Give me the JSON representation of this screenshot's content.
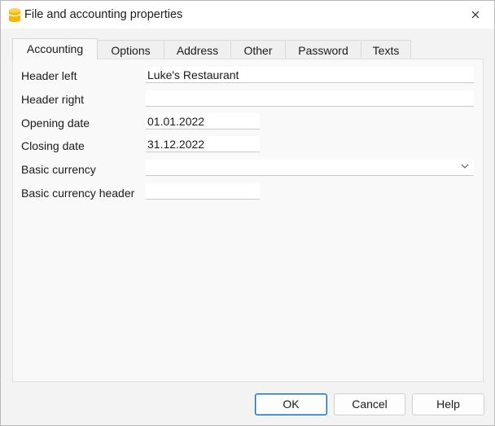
{
  "window": {
    "title": "File and accounting properties"
  },
  "tabs": [
    {
      "label": "Accounting",
      "active": true
    },
    {
      "label": "Options"
    },
    {
      "label": "Address"
    },
    {
      "label": "Other"
    },
    {
      "label": "Password"
    },
    {
      "label": "Texts"
    }
  ],
  "form": {
    "header_left": {
      "label": "Header left",
      "value": "Luke's Restaurant"
    },
    "header_right": {
      "label": "Header right",
      "value": ""
    },
    "opening_date": {
      "label": "Opening date",
      "value": "01.01.2022"
    },
    "closing_date": {
      "label": "Closing date",
      "value": "31.12.2022"
    },
    "basic_currency": {
      "label": "Basic currency",
      "value": ""
    },
    "basic_currency_header": {
      "label": "Basic currency header",
      "value": ""
    }
  },
  "buttons": {
    "ok": "OK",
    "cancel": "Cancel",
    "help": "Help"
  },
  "icons": {
    "app": "database-icon",
    "close": "close-icon",
    "dropdown": "chevron-down-icon"
  },
  "colors": {
    "accent": "#0067c0",
    "app_icon": "#f5b800"
  }
}
